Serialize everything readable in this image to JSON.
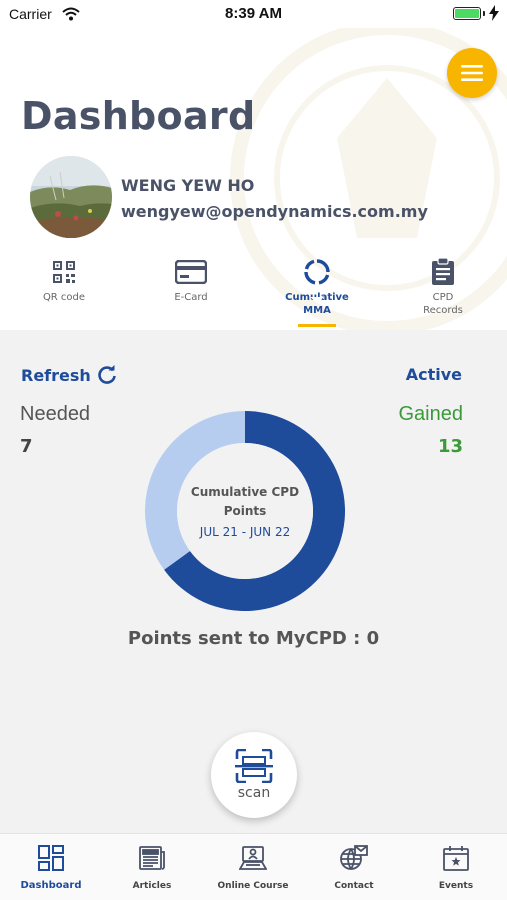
{
  "status_bar": {
    "carrier": "Carrier",
    "time": "8:39 AM",
    "wifi_icon": "wifi-icon",
    "battery_icon": "battery-charging-icon"
  },
  "header": {
    "title": "Dashboard",
    "menu_icon": "hamburger-menu-icon",
    "accent_color": "#f7b500",
    "user": {
      "name": "WENG YEW HO",
      "email": "wengyew@opendynamics.com.my"
    },
    "tabs": [
      {
        "label": "QR code",
        "icon": "qr-code-icon",
        "active": false
      },
      {
        "label": "E-Card",
        "icon": "id-card-icon",
        "active": false
      },
      {
        "label": "Cumulative MMA",
        "icon": "progress-ring-icon",
        "active": true
      },
      {
        "label": "CPD Records",
        "icon": "clipboard-icon",
        "active": false
      }
    ]
  },
  "main": {
    "refresh_label": "Refresh",
    "status": "Active",
    "needed_label": "Needed",
    "needed_value": "7",
    "gained_label": "Gained",
    "gained_value": "13",
    "chart_title": "Cumulative CPD Points",
    "chart_period": "JUL 21 - JUN 22",
    "mycpd_text": "Points sent to MyCPD : 0",
    "scan_label": "scan"
  },
  "chart_data": {
    "type": "pie",
    "categories": [
      "Gained",
      "Needed"
    ],
    "values": [
      13,
      7
    ],
    "colors": [
      "#1e4b9a",
      "#b6cdf0"
    ],
    "donut": true,
    "title": "Cumulative CPD Points"
  },
  "bottom_nav": {
    "items": [
      {
        "label": "Dashboard",
        "icon": "dashboard-icon",
        "active": true
      },
      {
        "label": "Articles",
        "icon": "newspaper-icon",
        "active": false
      },
      {
        "label": "Online Course",
        "icon": "online-course-icon",
        "active": false
      },
      {
        "label": "Contact",
        "icon": "globe-mail-icon",
        "active": false
      },
      {
        "label": "Events",
        "icon": "calendar-icon",
        "active": false
      }
    ]
  }
}
